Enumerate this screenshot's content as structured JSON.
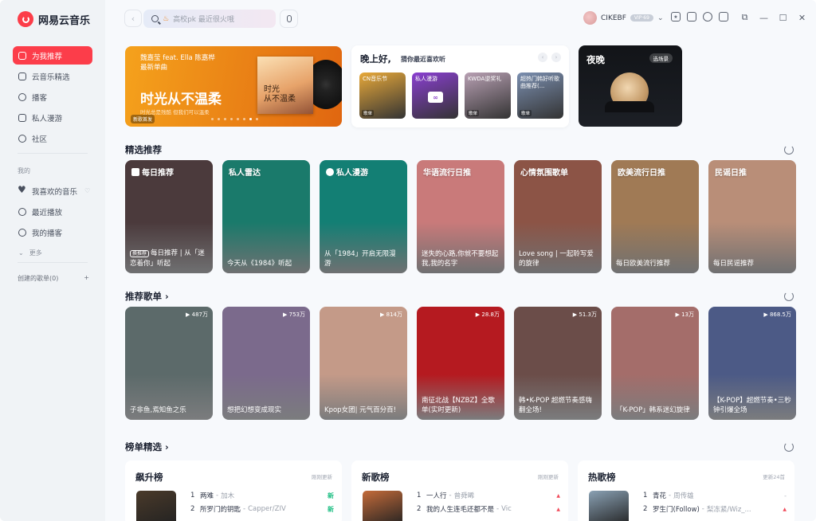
{
  "app": {
    "name": "网易云音乐"
  },
  "sidebar": {
    "items": [
      {
        "label": "为我推荐",
        "icon": "recommend-icon"
      },
      {
        "label": "云音乐精选",
        "icon": "featured-icon"
      },
      {
        "label": "播客",
        "icon": "podcast-icon"
      },
      {
        "label": "私人漫游",
        "icon": "roam-icon"
      },
      {
        "label": "社区",
        "icon": "community-icon"
      }
    ],
    "mine_title": "我的",
    "mine_items": [
      {
        "label": "我喜欢的音乐",
        "icon": "heart-icon"
      },
      {
        "label": "最近播放",
        "icon": "clock-icon"
      },
      {
        "label": "我的播客",
        "icon": "podcast-icon"
      }
    ],
    "more": "更多",
    "created_label": "创建的歌单(0)",
    "add": "+"
  },
  "search": {
    "placeholder": "高校pk 最近很火哦"
  },
  "user": {
    "name": "CIKEBF",
    "vip": "VIP·69"
  },
  "banner": {
    "artist": "魏嘉莹 feat. Ella 陈嘉桦",
    "label": "最新单曲",
    "title": "时光从不温柔",
    "subtitle": "时光总是残酷 但我们可以温柔",
    "tag": "新歌首发",
    "cover_text": "时光\n从不温柔"
  },
  "greeting": {
    "title": "晚上好,",
    "subtitle": "猜你最近喜欢听",
    "cards": [
      {
        "label": "CN音乐节",
        "tag": "歌单",
        "color": "#e8a93a"
      },
      {
        "label": "私人漫游",
        "tag": "",
        "color": "#8a3fd1"
      },
      {
        "label": "KWDA逆奖礼",
        "tag": "歌单",
        "color": "#b8a0b3"
      },
      {
        "label": "超热门韩好听歌曲推荐(...",
        "tag": "歌单",
        "color": "#7b8fb0"
      }
    ]
  },
  "night": {
    "title": "夜晚",
    "button": "选场景"
  },
  "sections": {
    "picks": "精选推荐",
    "playlists": "推荐歌单",
    "charts": "榜单精选"
  },
  "picks": [
    {
      "title": "每日推荐",
      "badge": "换推荐",
      "text": "每日推荐 | 从「迷恋着你」听起",
      "color": "#4b3a3c"
    },
    {
      "title": "私人雷达",
      "text": "今天从《1984》听起",
      "color": "#1a7a6b"
    },
    {
      "title": "私人漫游",
      "text": "从「1984」开启无限漫游",
      "color": "#137f74"
    },
    {
      "title": "华语流行日推",
      "text": "迷失的心路,你就不要想起我,我的名字",
      "color": "#c97a7a"
    },
    {
      "title": "心情氛围歌单",
      "text": "Love song | 一起聆写爱的旋律",
      "color": "#8c5446"
    },
    {
      "title": "欧美流行日推",
      "text": "每日欧美流行推荐",
      "color": "#a07a55"
    },
    {
      "title": "民谣日推",
      "text": "每日民谣推荐",
      "color": "#b98e78"
    }
  ],
  "playlists": [
    {
      "plays": "487万",
      "text": "子非鱼,焉知鱼之乐",
      "color": "#5c6a6a"
    },
    {
      "plays": "753万",
      "text": "想把幻想变成现实",
      "color": "#7b6a8c"
    },
    {
      "plays": "814万",
      "text": "Kpop女团| 元气百分百!",
      "color": "#c49a88"
    },
    {
      "plays": "28.8万",
      "text": "南征北战【NZBZ】全歌单(实时更新)",
      "color": "#b51a20"
    },
    {
      "plays": "51.3万",
      "text": "韩•K-POP 超燃节奏感嗨翻全场!",
      "color": "#6b4d49"
    },
    {
      "plays": "13万",
      "text": "「K-POP」韩系迷幻旋律",
      "color": "#a46d6a"
    },
    {
      "plays": "868.5万",
      "text": "【K-POP】超燃节奏•三秒钟引爆全场",
      "color": "#4c5a86"
    }
  ],
  "charts": [
    {
      "title": "飙升榜",
      "update": "刚刚更新",
      "color": "#4a3a2a",
      "rows": [
        {
          "rank": "1",
          "song": "两难",
          "artist": "加木",
          "status": "新",
          "kind": "new"
        },
        {
          "rank": "2",
          "song": "所罗门的钥匙",
          "artist": "Capper/ZIV",
          "status": "新",
          "kind": "new"
        }
      ]
    },
    {
      "title": "新歌榜",
      "update": "刚刚更新",
      "color": "#c46b3a",
      "rows": [
        {
          "rank": "1",
          "song": "一人行",
          "artist": "曾舜晞",
          "status": "▲",
          "kind": "up"
        },
        {
          "rank": "2",
          "song": "我的人生连毛还都不是",
          "artist": "Vic",
          "status": "▲",
          "kind": "up"
        }
      ]
    },
    {
      "title": "热歌榜",
      "update": "更新24首",
      "color": "#8aa1b4",
      "rows": [
        {
          "rank": "1",
          "song": "青花",
          "artist": "周传雄",
          "status": "-",
          "kind": "flat"
        },
        {
          "rank": "2",
          "song": "罗生门(Follow)",
          "artist": "梨冻紧/Wiz_...",
          "status": "▲",
          "kind": "up"
        }
      ]
    }
  ]
}
